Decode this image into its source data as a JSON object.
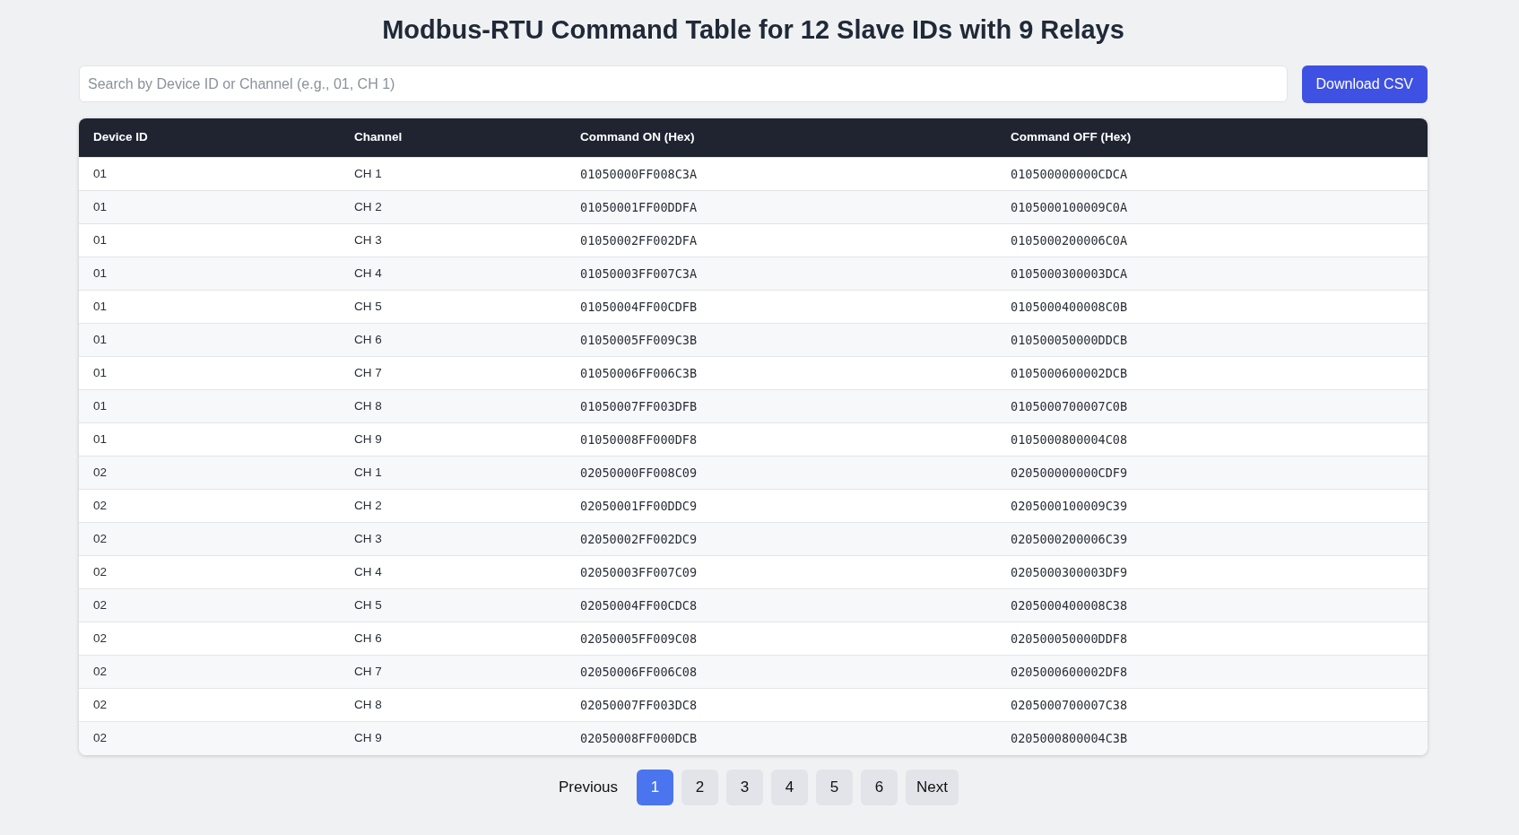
{
  "title": "Modbus-RTU Command Table for 12 Slave IDs with 9 Relays",
  "search": {
    "placeholder": "Search by Device ID or Channel (e.g., 01, CH 1)"
  },
  "download_button": "Download CSV",
  "table": {
    "columns": [
      "Device ID",
      "Channel",
      "Command ON (Hex)",
      "Command OFF (Hex)"
    ],
    "rows": [
      [
        "01",
        "CH 1",
        "01050000FF008C3A",
        "010500000000CDCA"
      ],
      [
        "01",
        "CH 2",
        "01050001FF00DDFA",
        "0105000100009C0A"
      ],
      [
        "01",
        "CH 3",
        "01050002FF002DFA",
        "0105000200006C0A"
      ],
      [
        "01",
        "CH 4",
        "01050003FF007C3A",
        "0105000300003DCA"
      ],
      [
        "01",
        "CH 5",
        "01050004FF00CDFB",
        "0105000400008C0B"
      ],
      [
        "01",
        "CH 6",
        "01050005FF009C3B",
        "010500050000DDCB"
      ],
      [
        "01",
        "CH 7",
        "01050006FF006C3B",
        "0105000600002DCB"
      ],
      [
        "01",
        "CH 8",
        "01050007FF003DFB",
        "0105000700007C0B"
      ],
      [
        "01",
        "CH 9",
        "01050008FF000DF8",
        "0105000800004C08"
      ],
      [
        "02",
        "CH 1",
        "02050000FF008C09",
        "020500000000CDF9"
      ],
      [
        "02",
        "CH 2",
        "02050001FF00DDC9",
        "0205000100009C39"
      ],
      [
        "02",
        "CH 3",
        "02050002FF002DC9",
        "0205000200006C39"
      ],
      [
        "02",
        "CH 4",
        "02050003FF007C09",
        "0205000300003DF9"
      ],
      [
        "02",
        "CH 5",
        "02050004FF00CDC8",
        "0205000400008C38"
      ],
      [
        "02",
        "CH 6",
        "02050005FF009C08",
        "020500050000DDF8"
      ],
      [
        "02",
        "CH 7",
        "02050006FF006C08",
        "0205000600002DF8"
      ],
      [
        "02",
        "CH 8",
        "02050007FF003DC8",
        "0205000700007C38"
      ],
      [
        "02",
        "CH 9",
        "02050008FF000DCB",
        "0205000800004C3B"
      ]
    ]
  },
  "pagination": [
    {
      "kind": "prev",
      "label": "Previous",
      "selected": false
    },
    {
      "kind": "page",
      "label": "1",
      "selected": true
    },
    {
      "kind": "page",
      "label": "2",
      "selected": false
    },
    {
      "kind": "page",
      "label": "3",
      "selected": false
    },
    {
      "kind": "page",
      "label": "4",
      "selected": false
    },
    {
      "kind": "page",
      "label": "5",
      "selected": false
    },
    {
      "kind": "page",
      "label": "6",
      "selected": false
    },
    {
      "kind": "next",
      "label": "Next",
      "selected": false
    }
  ]
}
